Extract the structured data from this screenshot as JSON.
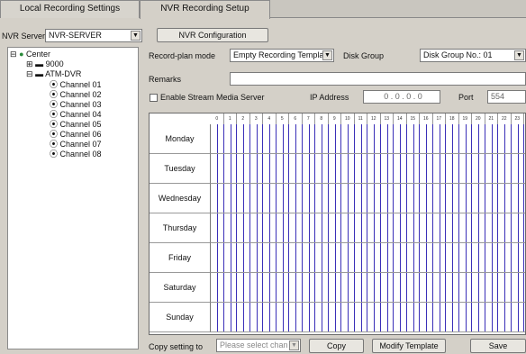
{
  "tabs": [
    {
      "label": "Local Recording Settings"
    },
    {
      "label": "NVR Recording Setup"
    }
  ],
  "nvr_server": {
    "label": "NVR Server",
    "value": "NVR-SERVER"
  },
  "nvr_config_button": "NVR Configuration",
  "tree": {
    "root": "Center",
    "nodes": [
      {
        "label": "9000"
      },
      {
        "label": "ATM-DVR"
      }
    ],
    "channels": [
      "Channel 01",
      "Channel 02",
      "Channel 03",
      "Channel 04",
      "Channel 05",
      "Channel 06",
      "Channel 07",
      "Channel 08"
    ]
  },
  "record_plan": {
    "label": "Record-plan mode",
    "value": "Empty Recording Templa"
  },
  "disk_group": {
    "label": "Disk Group",
    "value": "Disk Group No.: 01"
  },
  "remarks": {
    "label": "Remarks",
    "value": ""
  },
  "stream": {
    "label": "Enable Stream Media Server",
    "checked": false
  },
  "ip": {
    "label": "IP Address",
    "value": "0 . 0 . 0 . 0"
  },
  "port": {
    "label": "Port",
    "value": "554"
  },
  "hours": [
    "0",
    "1",
    "2",
    "3",
    "4",
    "5",
    "6",
    "7",
    "8",
    "9",
    "10",
    "11",
    "12",
    "13",
    "14",
    "15",
    "16",
    "17",
    "18",
    "19",
    "20",
    "21",
    "22",
    "23"
  ],
  "days": [
    "Monday",
    "Tuesday",
    "Wednesday",
    "Thursday",
    "Friday",
    "Saturday",
    "Sunday"
  ],
  "copy_setting": {
    "label": "Copy setting to",
    "placeholder": "Please select chan"
  },
  "buttons": {
    "copy": "Copy",
    "modify": "Modify Template",
    "save": "Save"
  },
  "colors": {
    "grid_line": "#3a2fb8",
    "selection": "#1f5fd1"
  }
}
